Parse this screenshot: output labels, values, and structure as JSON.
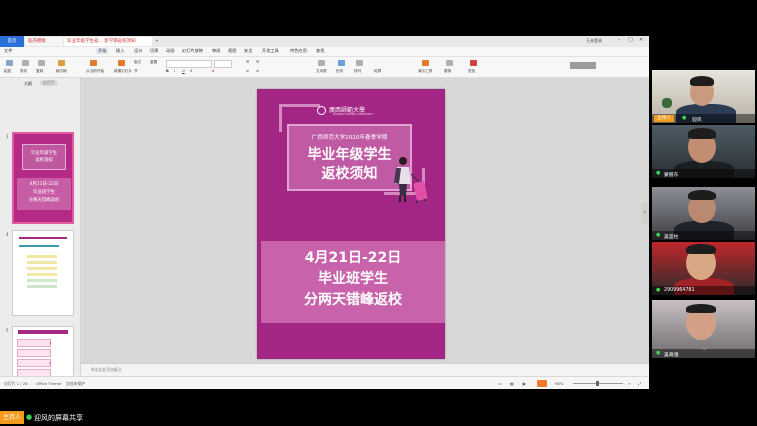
{
  "wps": {
    "tabs": [
      "首页",
      "稻壳模板",
      "毕业年级学生返... 新学期返校须知",
      "+"
    ],
    "account": "王未登录",
    "menu": [
      "文件",
      "开始",
      "插入",
      "设计",
      "切换",
      "动画",
      "幻灯片放映",
      "审阅",
      "视图",
      "安全",
      "开发工具",
      "特色应用",
      "查找"
    ],
    "active_menu": "开始",
    "ribbon": [
      "粘贴",
      "剪切",
      "复制",
      "格式刷",
      "从当前开始",
      "新建幻灯片",
      "版式",
      "节",
      "重置",
      "文本框",
      "形状",
      "排列",
      "轮廓",
      "演示工具",
      "替换",
      "查找"
    ],
    "pane_tabs": [
      "大纲",
      "幻灯片"
    ],
    "thumb_numbers": [
      "1",
      "4",
      "5"
    ],
    "thumb1_lines": [
      "毕业年级学生",
      "返校须知",
      "4月21日-22日",
      "毕业班学生",
      "分两天错峰返校"
    ],
    "notes_placeholder": "单击此处添加备注",
    "status": [
      "幻灯片 1 / 28",
      "Office Theme",
      "文档未保护"
    ],
    "zoom": "98%"
  },
  "slide": {
    "logo": "廣西師範大學",
    "logo_sub": "GUANGXI NORMAL UNIVERSITY",
    "subtitle": "广西师范大学2020年春季学期",
    "title_line1": "毕业年级学生",
    "title_line2": "返校须知",
    "date_line": "4月21日-22日",
    "line2": "毕业班学生",
    "line3": "分两天错峰返校"
  },
  "participants": [
    {
      "name": "迎风",
      "host": true
    },
    {
      "name": "蒙丽东",
      "host": false
    },
    {
      "name": "吴蓝柱",
      "host": false
    },
    {
      "name": "2909964781",
      "host": false
    },
    {
      "name": "吴海涵",
      "host": false
    }
  ],
  "host_label": "主持人",
  "bottom": {
    "badge": "主持人",
    "text": "迎风的屏幕共享"
  },
  "colors": {
    "slide_bg": "#a32684",
    "accent_band": "#c762ab",
    "host_badge": "#f29b1d",
    "mic_on": "#3fd25b",
    "wps_blue": "#2b6fd8"
  }
}
